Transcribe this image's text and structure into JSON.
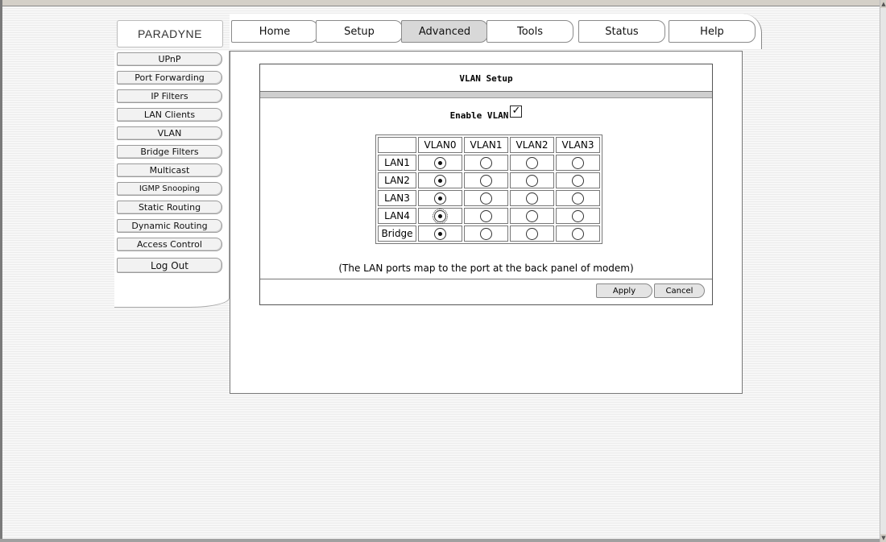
{
  "brand": {
    "logo_text": "PARADYNE"
  },
  "topnav": {
    "tabs": [
      {
        "label": "Home"
      },
      {
        "label": "Setup"
      },
      {
        "label": "Advanced",
        "active": true
      },
      {
        "label": "Tools"
      },
      {
        "label": "Status"
      },
      {
        "label": "Help"
      }
    ]
  },
  "sidebar": {
    "items": [
      {
        "label": "UPnP"
      },
      {
        "label": "Port Forwarding"
      },
      {
        "label": "IP Filters"
      },
      {
        "label": "LAN Clients"
      },
      {
        "label": "VLAN"
      },
      {
        "label": "Bridge Filters"
      },
      {
        "label": "Multicast"
      },
      {
        "label": "IGMP Snooping"
      },
      {
        "label": "Static Routing"
      },
      {
        "label": "Dynamic Routing"
      },
      {
        "label": "Access Control"
      },
      {
        "label": "Log Out"
      }
    ]
  },
  "vlan_setup": {
    "title": "VLAN Setup",
    "enable_label": "Enable VLAN",
    "enable_checked": true,
    "columns": [
      "VLAN0",
      "VLAN1",
      "VLAN2",
      "VLAN3"
    ],
    "rows": [
      {
        "label": "LAN1",
        "selected": 0
      },
      {
        "label": "LAN2",
        "selected": 0
      },
      {
        "label": "LAN3",
        "selected": 0
      },
      {
        "label": "LAN4",
        "selected": 0,
        "focused": true
      },
      {
        "label": "Bridge",
        "selected": 0
      }
    ],
    "note": "(The LAN ports map to the port at the back panel of modem)",
    "apply_label": "Apply",
    "cancel_label": "Cancel"
  },
  "colors": {
    "active_tab": "#d8d8d8",
    "panel_bg": "#ffffff",
    "page_stripes": "#ececec"
  }
}
